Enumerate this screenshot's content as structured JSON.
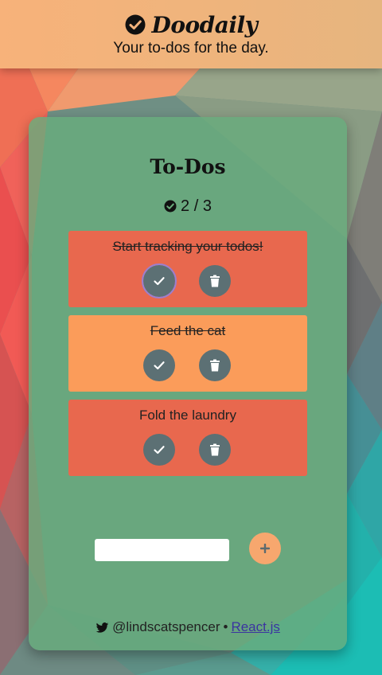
{
  "header": {
    "app_name": "Doodaily",
    "tagline": "Your to-dos for the day.",
    "icon": "check-circle-icon"
  },
  "card": {
    "title": "To-Dos",
    "progress": {
      "icon": "check-circle-icon",
      "label": "2 / 3",
      "completed": 2,
      "total": 3
    }
  },
  "todos": [
    {
      "text": "Start tracking your todos!",
      "done": true,
      "color": "#e8684e"
    },
    {
      "text": "Feed the cat",
      "done": true,
      "color": "#fb9c5a"
    },
    {
      "text": "Fold the laundry",
      "done": false,
      "color": "#e8684e"
    }
  ],
  "new_todo": {
    "value": "",
    "placeholder": "",
    "add_icon": "plus-icon"
  },
  "footer": {
    "icon": "twitter-icon",
    "handle": "@lindscatspencer",
    "separator": "•",
    "link_label": "React.js"
  },
  "colors": {
    "header_bg": "#f5b27c",
    "card_bg": "#6aad7c",
    "todo_red": "#e8684e",
    "todo_orange": "#fb9c5a",
    "button_bg": "#5c7074",
    "add_button_bg": "#f7a76e"
  }
}
